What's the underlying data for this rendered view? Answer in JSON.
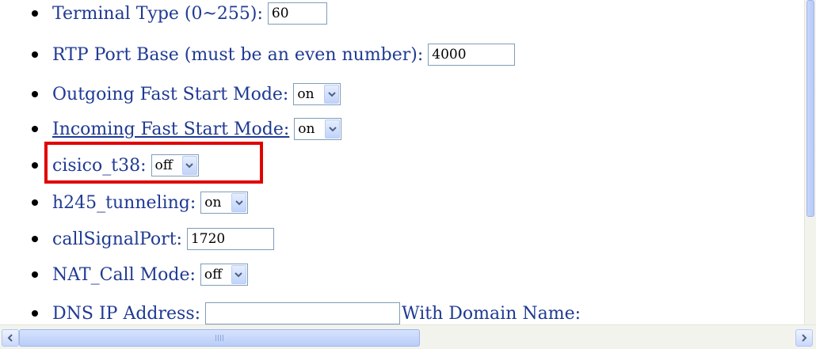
{
  "settings": [
    {
      "label": "Terminal Type (0~255):",
      "type": "text",
      "value": "60"
    },
    {
      "label": "RTP Port Base (must be an even number):",
      "type": "text",
      "value": "4000"
    },
    {
      "label": "Outgoing Fast Start Mode:",
      "type": "select",
      "value": "on"
    },
    {
      "label": "Incoming Fast Start Mode:",
      "type": "select",
      "value": "on"
    },
    {
      "label": "cisico_t38:",
      "type": "select",
      "value": "off"
    },
    {
      "label": "h245_tunneling:",
      "type": "select",
      "value": "on"
    },
    {
      "label": "callSignalPort:",
      "type": "text",
      "value": "1720"
    },
    {
      "label": "NAT_Call Mode:",
      "type": "select",
      "value": "off"
    },
    {
      "label": "DNS IP Address:",
      "type": "text",
      "value": "",
      "suffix": "With Domain Name:"
    }
  ],
  "colors": {
    "text": "#1f3a93",
    "highlight": "#e00000"
  },
  "icons": {
    "dropdown": "chevron-down-icon",
    "scroll_left": "arrow-left-icon",
    "scroll_right": "arrow-right-icon"
  }
}
